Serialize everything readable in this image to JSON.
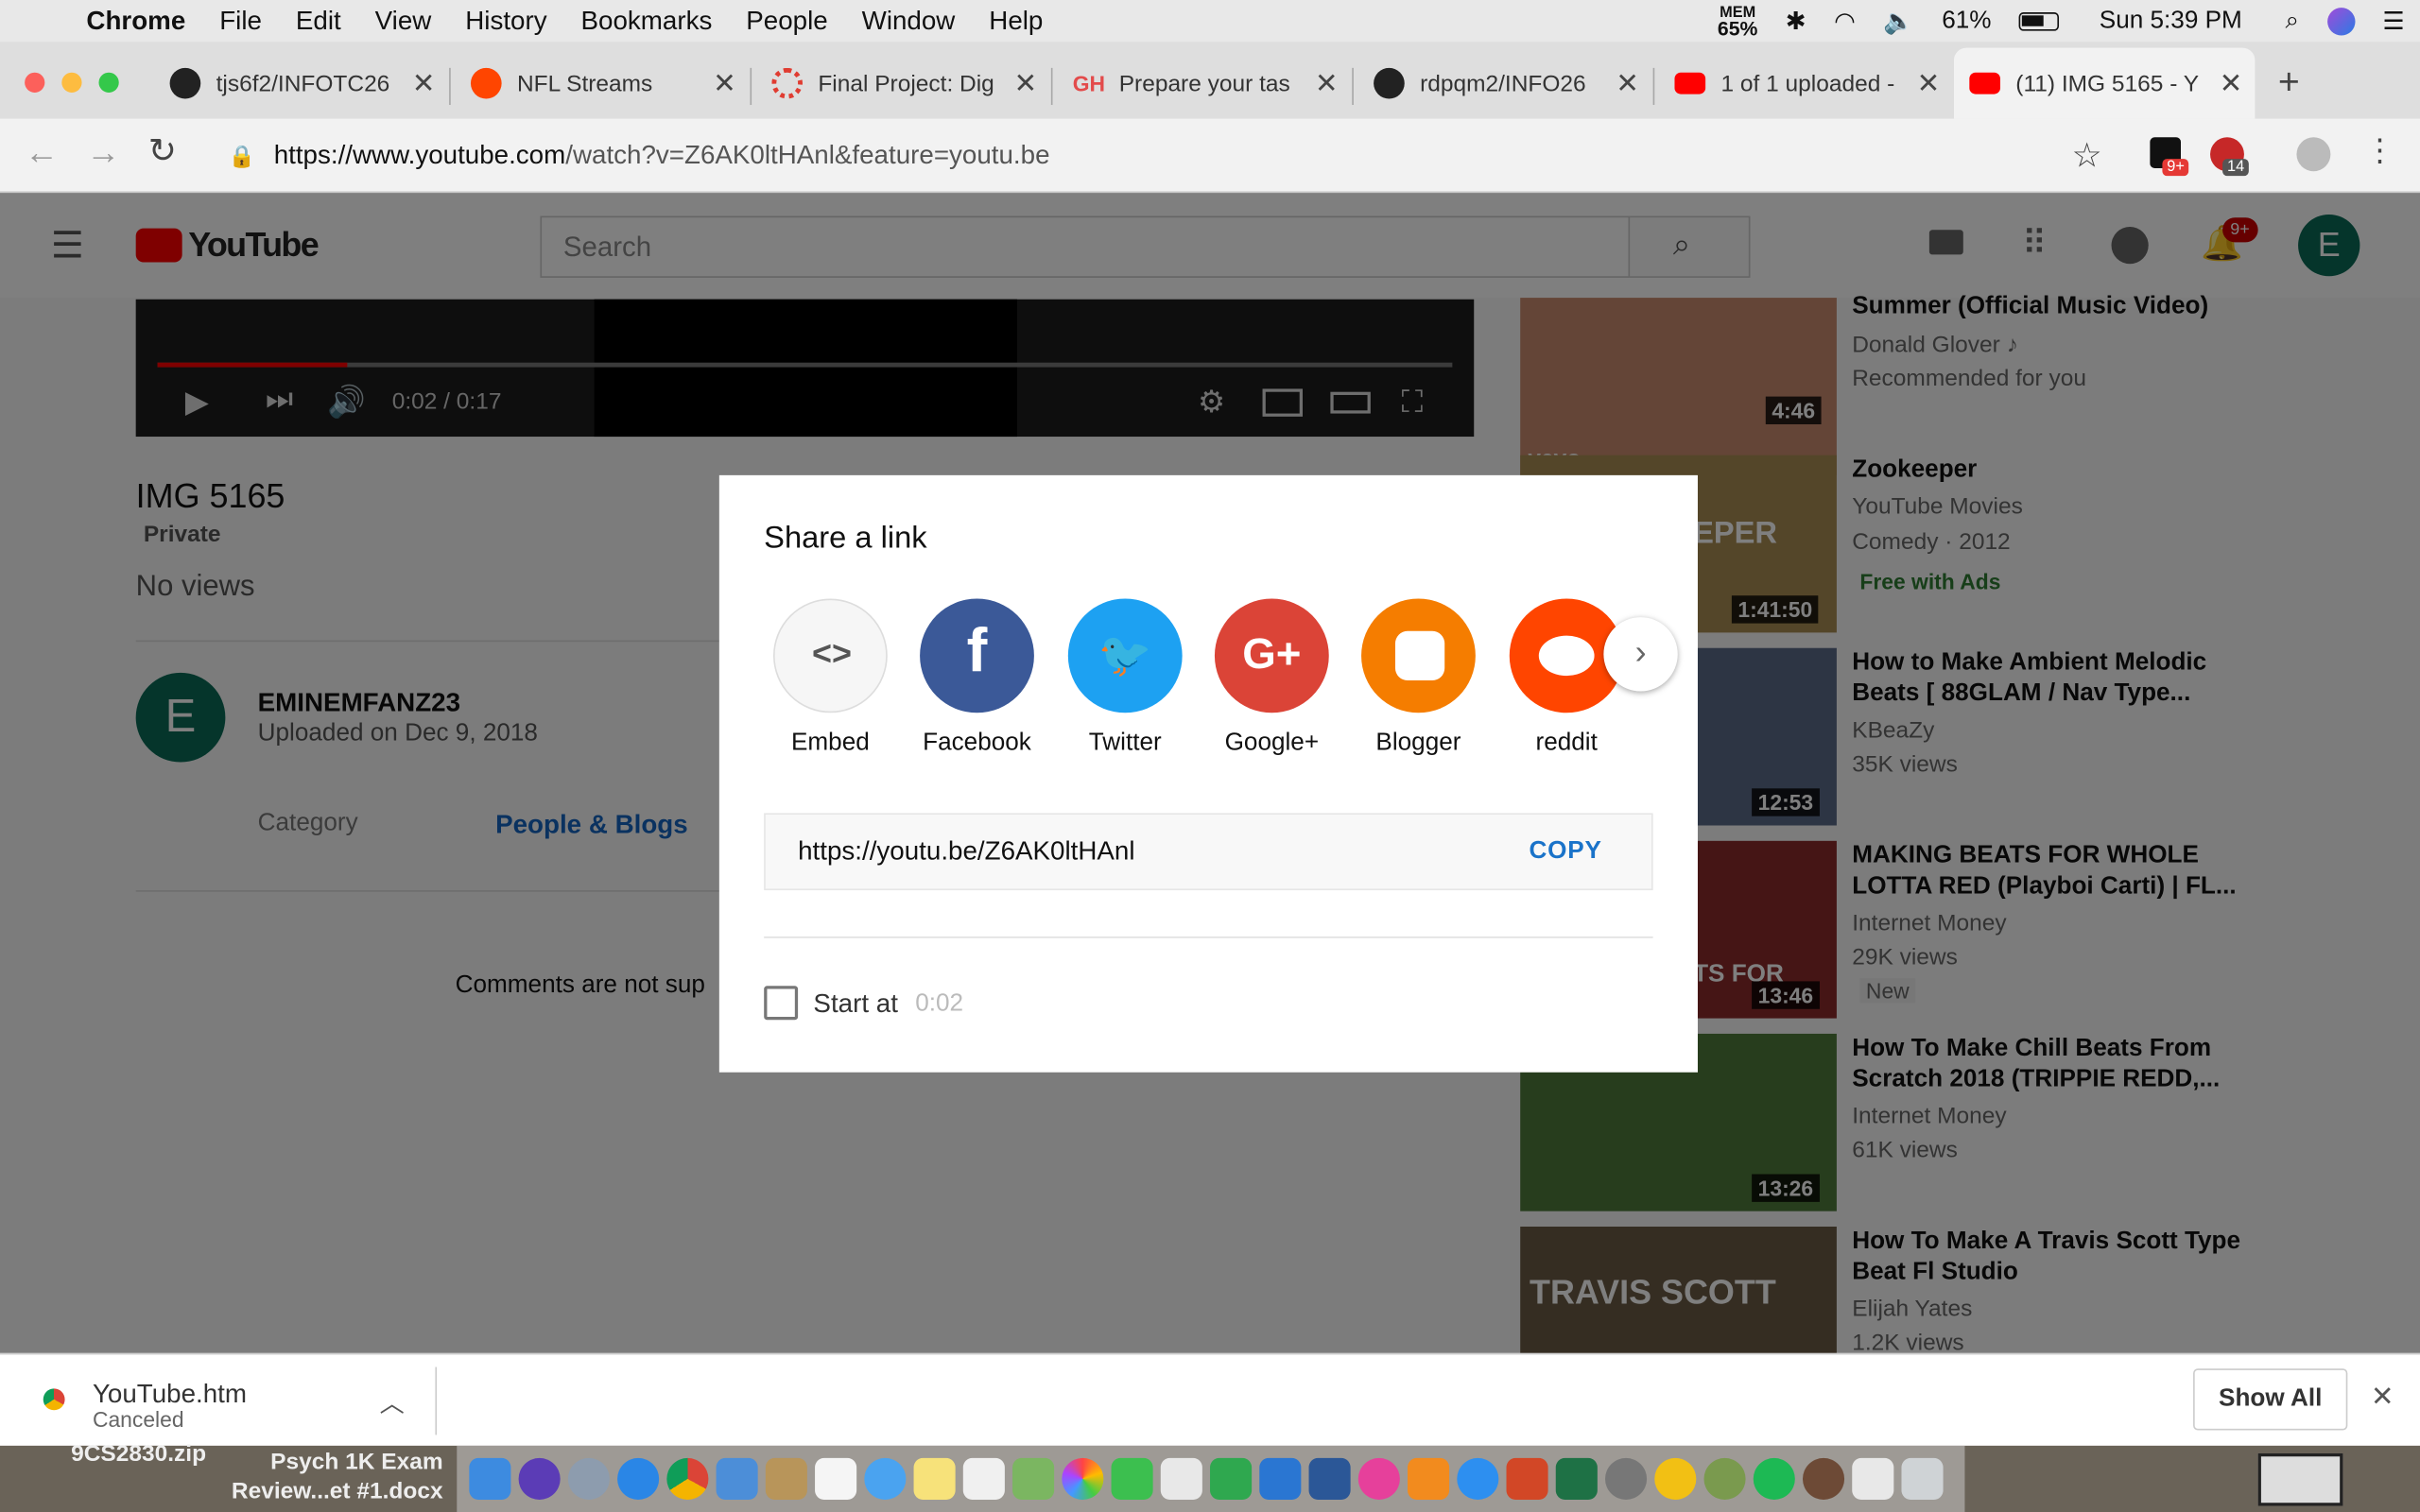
{
  "menubar": {
    "app_name": "Chrome",
    "menus": [
      "File",
      "Edit",
      "View",
      "History",
      "Bookmarks",
      "People",
      "Window",
      "Help"
    ],
    "mem_label": "MEM",
    "mem_value": "65%",
    "battery": "61%",
    "clock": "Sun 5:39 PM"
  },
  "tabs": [
    {
      "label": "tjs6f2/INFOTC26",
      "icon": "github-icon",
      "color": "#222222"
    },
    {
      "label": "NFL Streams",
      "icon": "reddit-icon",
      "color": "#ff4500"
    },
    {
      "label": "Final Project: Dig",
      "icon": "canvas-icon",
      "color": "#e03c31"
    },
    {
      "label": "Prepare your tas",
      "icon": "gh-icon",
      "color": "#e34b4b"
    },
    {
      "label": "rdpqm2/INFO26",
      "icon": "github-icon",
      "color": "#222222"
    },
    {
      "label": "1 of 1 uploaded -",
      "icon": "youtube-icon",
      "color": "#ff0000"
    },
    {
      "label": "(11) IMG 5165 - Y",
      "icon": "youtube-icon",
      "color": "#ff0000"
    }
  ],
  "omnibar": {
    "url_host": "https://www.youtube.com",
    "url_path": "/watch?v=Z6AK0ltHAnl&feature=youtu.be",
    "ext_badge_1": "9+",
    "ext_badge_2": "14"
  },
  "youtube": {
    "logo_text": "YouTube",
    "search_placeholder": "Search",
    "notification_count": "9+",
    "avatar_letter": "E",
    "player_time": "0:02 / 0:17",
    "video_title": "IMG 5165",
    "privacy": "Private",
    "views": "No views",
    "channel_avatar": "E",
    "channel_name": "EMINEMFANZ23",
    "upload_date": "Uploaded on Dec 9, 2018",
    "category_label": "Category",
    "category_value": "People & Blogs",
    "comments_note": "Comments are not sup"
  },
  "recommendations": [
    {
      "title": "Summer (Official Music Video)",
      "channel": "Donald Glover ♪",
      "meta": "Recommended for you",
      "badge": "",
      "duration": "4:46",
      "thumb_color": "#c98a6e",
      "thumb_text": "vevo"
    },
    {
      "title": "Zookeeper",
      "channel": "YouTube Movies",
      "meta": "Comedy · 2012",
      "badge": "Free with Ads",
      "duration": "1:41:50",
      "thumb_color": "#a88c52",
      "thumb_text": "EPER"
    },
    {
      "title": "How to Make Ambient Melodic Beats [ 88GLAM / Nav Type...",
      "channel": "KBeaZy",
      "meta": "35K views",
      "badge": "",
      "duration": "12:53",
      "thumb_color": "#5a6a88",
      "thumb_text": ""
    },
    {
      "title": "MAKING BEATS FOR WHOLE LOTTA RED (Playboi Carti) | FL...",
      "channel": "Internet Money",
      "meta": "29K views",
      "badge": "New",
      "duration": "13:46",
      "thumb_color": "#8a2a2a",
      "thumb_text": "TS FOR"
    },
    {
      "title": "How To Make Chill Beats From Scratch 2018 (TRIPPIE REDD,...",
      "channel": "Internet Money",
      "meta": "61K views",
      "badge": "",
      "duration": "13:26",
      "thumb_color": "#4f7a3a",
      "thumb_text": ""
    },
    {
      "title": "How To Make A Travis Scott Type Beat Fl Studio",
      "channel": "Elijah Yates",
      "meta": "1.2K views",
      "badge": "",
      "duration": "",
      "thumb_color": "#6b5a44",
      "thumb_text": "TRAVIS SCOTT"
    }
  ],
  "share_dialog": {
    "title": "Share a link",
    "targets": [
      {
        "label": "Embed",
        "icon": "embed-icon",
        "color": "#f6f6f6",
        "glyph": "< >"
      },
      {
        "label": "Facebook",
        "icon": "facebook-icon",
        "color": "#3b5998",
        "glyph": "f"
      },
      {
        "label": "Twitter",
        "icon": "twitter-icon",
        "color": "#1da1f2",
        "glyph": "🐦"
      },
      {
        "label": "Google+",
        "icon": "google-plus-icon",
        "color": "#db4437",
        "glyph": "G+"
      },
      {
        "label": "Blogger",
        "icon": "blogger-icon",
        "color": "#f57d00",
        "glyph": "B"
      },
      {
        "label": "reddit",
        "icon": "reddit-icon",
        "color": "#ff4500",
        "glyph": "👽"
      }
    ],
    "short_url": "https://youtu.be/Z6AK0ltHAnl",
    "copy_label": "COPY",
    "start_at_label": "Start at",
    "start_at_time": "0:02"
  },
  "download_bar": {
    "file_name": "YouTube.htm",
    "status": "Canceled",
    "show_all": "Show All"
  },
  "desktop": {
    "file1": "9CS2830.zip",
    "file2_line1": "Psych 1K Exam",
    "file2_line2": "Review...et #1.docx"
  }
}
